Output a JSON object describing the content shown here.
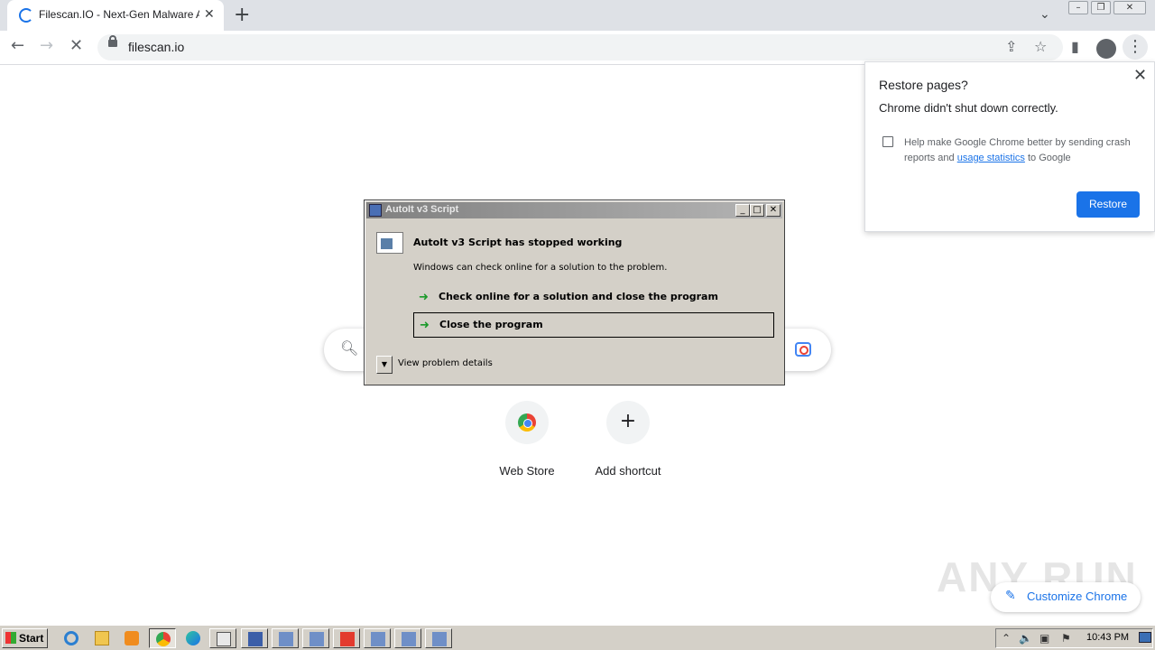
{
  "browser": {
    "tab": {
      "title": "Filescan.IO - Next-Gen Malware Ana",
      "close_label": "✕"
    },
    "new_tab_label": "+",
    "tab_search_label": "⌄",
    "window_controls": {
      "minimize": "–",
      "maximize": "❐",
      "close": "✕"
    },
    "nav": {
      "back": "←",
      "forward": "→",
      "stop": "✕"
    },
    "address": {
      "url": "filescan.io"
    },
    "toolbar_icons": {
      "share": "⇪",
      "bookmark": "☆",
      "side_panel": "▮",
      "menu": "⋮"
    }
  },
  "restore_popup": {
    "title": "Restore pages?",
    "message": "Chrome didn't shut down correctly.",
    "help_prefix": "Help make Google Chrome better by sending crash reports and ",
    "help_link": "usage statistics",
    "help_suffix": " to Google",
    "button": "Restore",
    "close_label": "✕"
  },
  "ntp": {
    "shortcuts": [
      {
        "label": "Web Store"
      },
      {
        "label": "Add shortcut",
        "icon": "+"
      }
    ],
    "customize_label": "Customize Chrome",
    "watermark": "ANY RUN"
  },
  "dialog": {
    "title": "AutoIt v3 Script",
    "heading": "AutoIt v3 Script has stopped working",
    "subtext": "Windows can check online for a solution to the problem.",
    "options": [
      {
        "label": "Check online for a solution and close the program",
        "arrow": "➜"
      },
      {
        "label": "Close the program",
        "arrow": "➜"
      }
    ],
    "details_label": "View problem details",
    "details_arrow": "▼",
    "buttons": {
      "min": "_",
      "max": "□",
      "close": "✕"
    }
  },
  "taskbar": {
    "start_label": "Start",
    "clock": "10:43 PM",
    "tray_icons": {
      "up": "⌃",
      "volume": "🔈",
      "network": "▣",
      "flag": "⚑"
    }
  },
  "colors": {
    "accent": "#1a73e8",
    "dialog_bg": "#d4d0c8",
    "tabstrip": "#dee1e6"
  }
}
